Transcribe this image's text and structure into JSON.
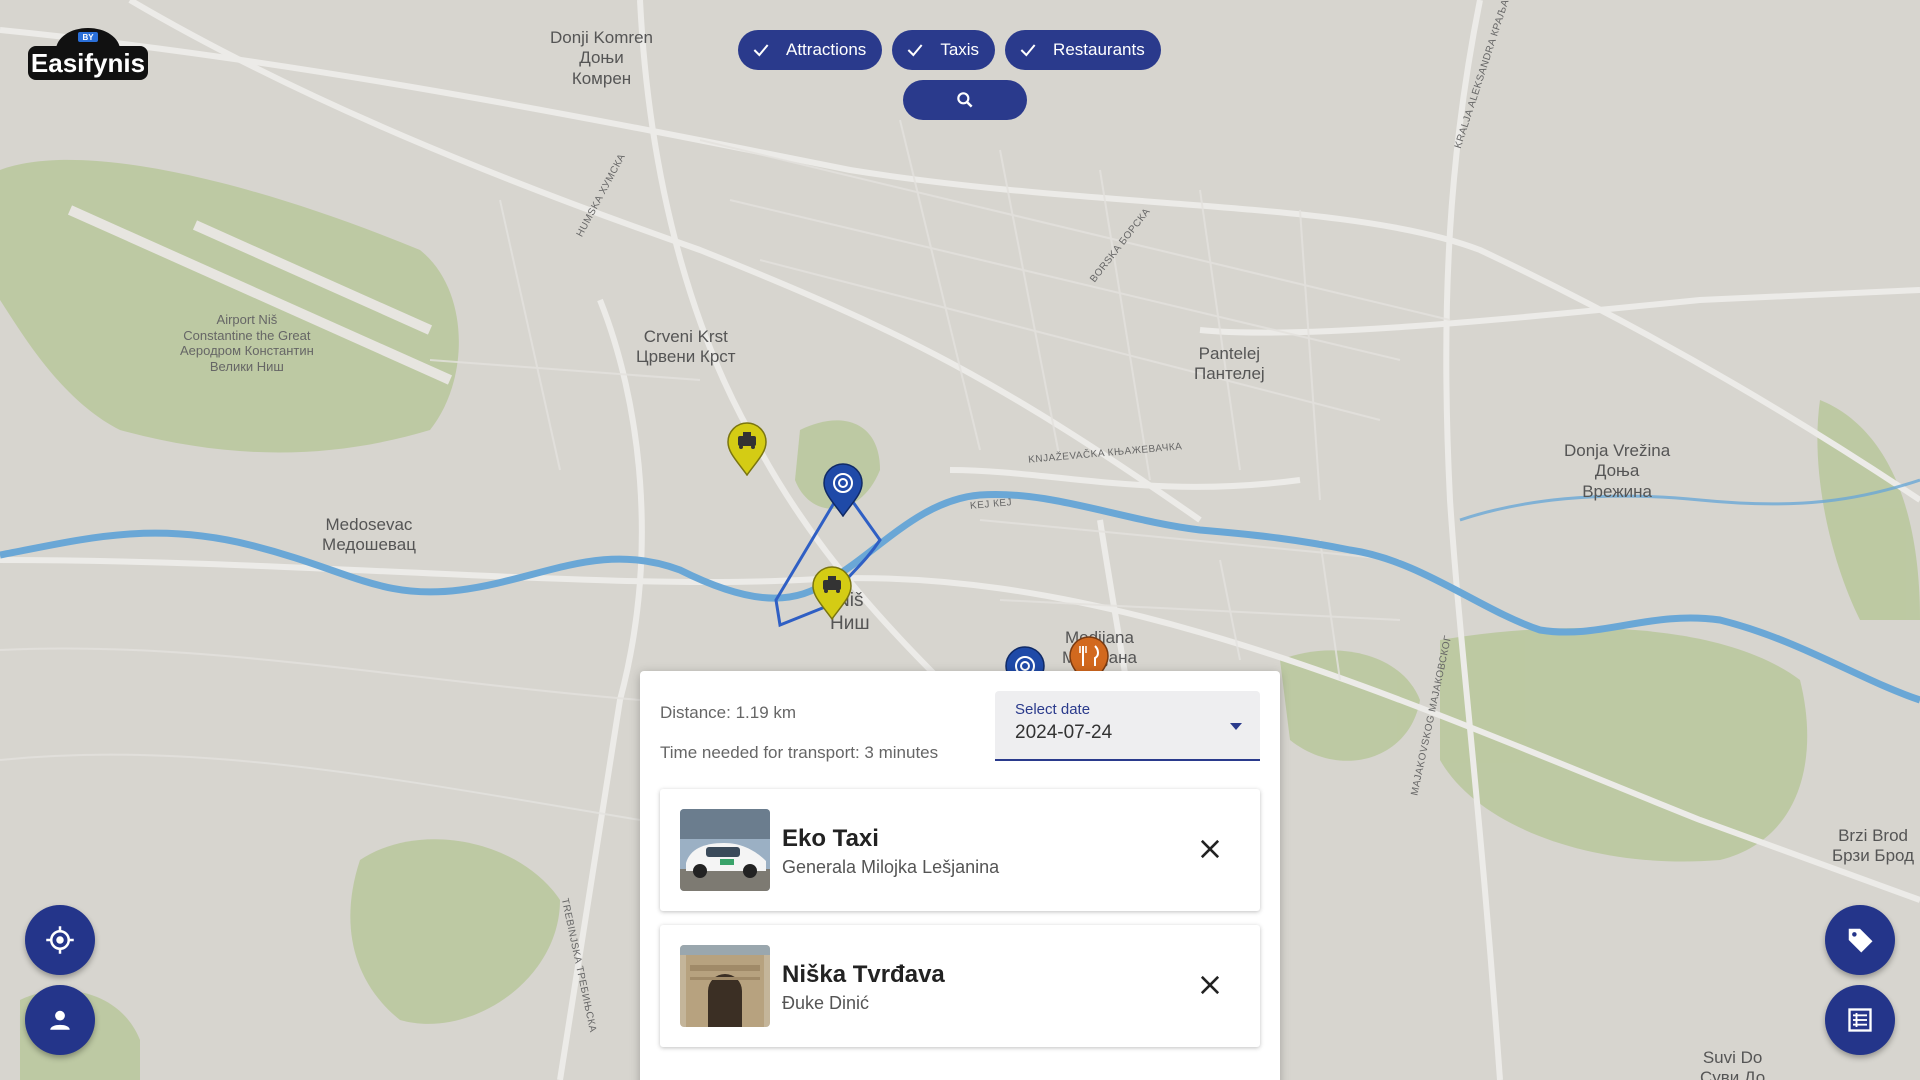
{
  "app": {
    "logo_text": "Easifynis",
    "logo_badge": "BY"
  },
  "filters": [
    {
      "label": "Attractions",
      "checked": true
    },
    {
      "label": "Taxis",
      "checked": true
    },
    {
      "label": "Restaurants",
      "checked": true
    }
  ],
  "search": {
    "icon": "search-icon"
  },
  "map": {
    "places": [
      {
        "lines": [
          "Donji Komren",
          "Доњи",
          "Комрен"
        ]
      },
      {
        "lines": [
          "Crveni Krst",
          "Црвени Крст"
        ]
      },
      {
        "lines": [
          "Pantelej",
          "Пантелеј"
        ]
      },
      {
        "lines": [
          "Donja Vrežina",
          "Доња",
          "Врежина"
        ]
      },
      {
        "lines": [
          "Medosevac",
          "Медошевац"
        ]
      },
      {
        "lines": [
          "Niš",
          "Ниш"
        ]
      },
      {
        "lines": [
          "Medijana",
          "Медијана"
        ]
      },
      {
        "lines": [
          "Brzi Brod",
          "Брзи Брод"
        ]
      },
      {
        "lines": [
          "Suvi Do",
          "Суви До"
        ]
      },
      {
        "lines": [
          "Airport Niš",
          "Constantine the Great",
          "Аеродром Константин",
          "Велики Ниш"
        ]
      }
    ],
    "streets": [
      "HUMSKA ХУМСКА",
      "BORSKA БОРСКА",
      "KNJAŽEVAČKA КЊАЖЕВАЧКА",
      "KEJ КЕЈ",
      "MAJAKOVSKOG МАЈАКОВСКОГ",
      "TREBINJSKA ТРЕБИЊСКА",
      "KRALJA ALEKSANDRA КРАЉА АЛ"
    ],
    "markers": [
      "taxi",
      "attraction",
      "taxi",
      "attraction",
      "restaurant"
    ],
    "route_color": "#2f5fc4",
    "river_color": "#6aa7d6"
  },
  "panel": {
    "distance": "Distance: 1.19 km",
    "time": "Time needed for transport: 3 minutes",
    "date_label": "Select date",
    "date_value": "2024-07-24",
    "cards": [
      {
        "title": "Eko Taxi",
        "subtitle": "Generala Milojka Lešjanina"
      },
      {
        "title": "Niška Tvrđava",
        "subtitle": "Đuke Dinić"
      }
    ]
  },
  "fabs": {
    "left": [
      "locate-icon",
      "person-icon"
    ],
    "right": [
      "tag-icon",
      "list-icon"
    ]
  },
  "colors": {
    "accent": "#24358a",
    "taxi": "#d4cc14",
    "attraction": "#1f4aa8",
    "restaurant": "#d2691e"
  }
}
